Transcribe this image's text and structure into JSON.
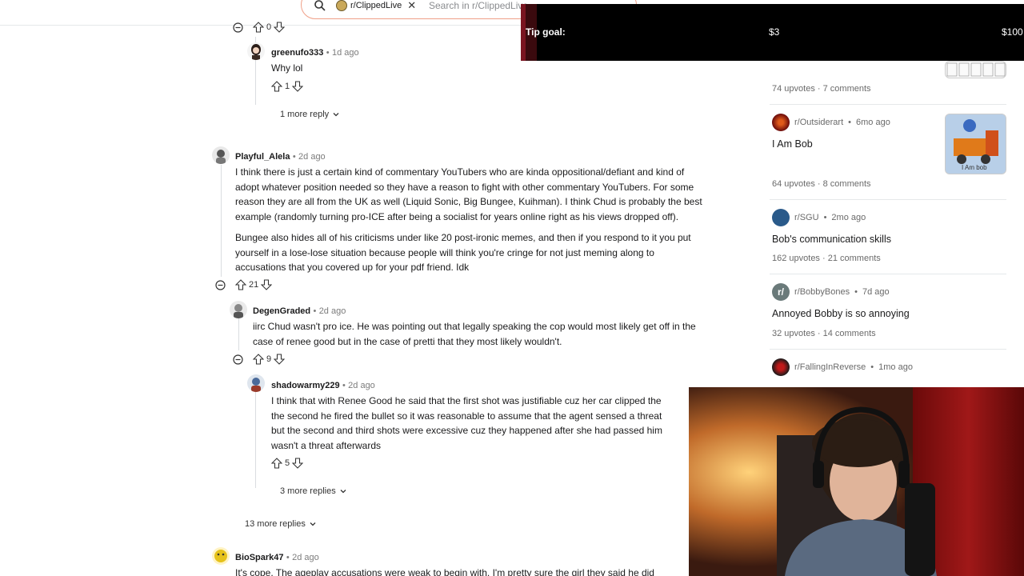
{
  "search": {
    "chip_label": "r/ClippedLive",
    "placeholder": "Search in r/ClippedLive"
  },
  "tip": {
    "label": "Tip goal:",
    "current": "$3",
    "goal": "$100",
    "bar_color": "#7a1420"
  },
  "comments": {
    "top_votes": "0",
    "greenufo": {
      "user": "greenufo333",
      "time": "1d ago",
      "text": "Why lol",
      "votes": "1",
      "more": "1 more reply"
    },
    "playful": {
      "user": "Playful_Alela",
      "time": "2d ago",
      "p1": [
        "I think there is just a certain kind of commentary YouTubers who are kinda oppositional/defiant and kind of",
        "adopt whatever position needed so they have a reason to fight with other commentary YouTubers. For some",
        "reason they are all from the UK as well (Liquid Sonic, Big Bungee, Kuihman). I think Chud is probably the best",
        "example (randomly turning pro-ICE after being a socialist for years online right as his views dropped off)."
      ],
      "p2": [
        "Bungee also hides all of his criticisms under like 20 post-ironic memes, and then if you respond to it you put",
        "yourself in a lose-lose situation because people will think you're cringe for not just meming along to",
        "accusations that you covered up for your pdf friend. Idk"
      ],
      "votes": "21"
    },
    "degen": {
      "user": "DegenGraded",
      "time": "2d ago",
      "lines": [
        "iirc Chud wasn't pro ice. He was pointing out that legally speaking the cop would most likely get off in the",
        "case of renee good but in the case of pretti that they most likely wouldn't."
      ],
      "votes": "9"
    },
    "shadow": {
      "user": "shadowarmy229",
      "time": "2d ago",
      "lines": [
        "I think that with Renee Good he said that the first shot was justifiable cuz her car clipped the",
        "the second he fired the bullet so it was reasonable to assume that the agent sensed a threat",
        "but the second and third shots were excessive cuz they happened after she had passed him",
        "wasn't a threat afterwards"
      ],
      "votes": "5",
      "more": "3 more replies"
    },
    "more13": "13 more replies",
    "bio": {
      "user": "BioSpark47",
      "time": "2d ago",
      "text": "It's cope. The ageplay accusations were weak to begin with. I'm pretty sure the girl they said he did"
    }
  },
  "sidebar": [
    {
      "stats": [
        "74 upvotes",
        "7 comments"
      ]
    },
    {
      "sub": "r/Outsiderart",
      "time": "6mo ago",
      "title": "I Am Bob",
      "stats": [
        "64 upvotes",
        "8 comments"
      ],
      "color": "#8b1a0a"
    },
    {
      "sub": "r/SGU",
      "time": "2mo ago",
      "title": "Bob's communication skills",
      "stats": [
        "162 upvotes",
        "21 comments"
      ],
      "color": "#2a5a8a"
    },
    {
      "sub": "r/BobbyBones",
      "time": "7d ago",
      "title": "Annoyed Bobby is so annoying",
      "stats": [
        "32 upvotes",
        "14 comments"
      ],
      "color": "#6a7a7a"
    },
    {
      "sub": "r/FallingInReverse",
      "time": "1mo ago",
      "color": "#1a1a1a"
    }
  ],
  "thumb_text": "I Am bob",
  "dot": "•"
}
